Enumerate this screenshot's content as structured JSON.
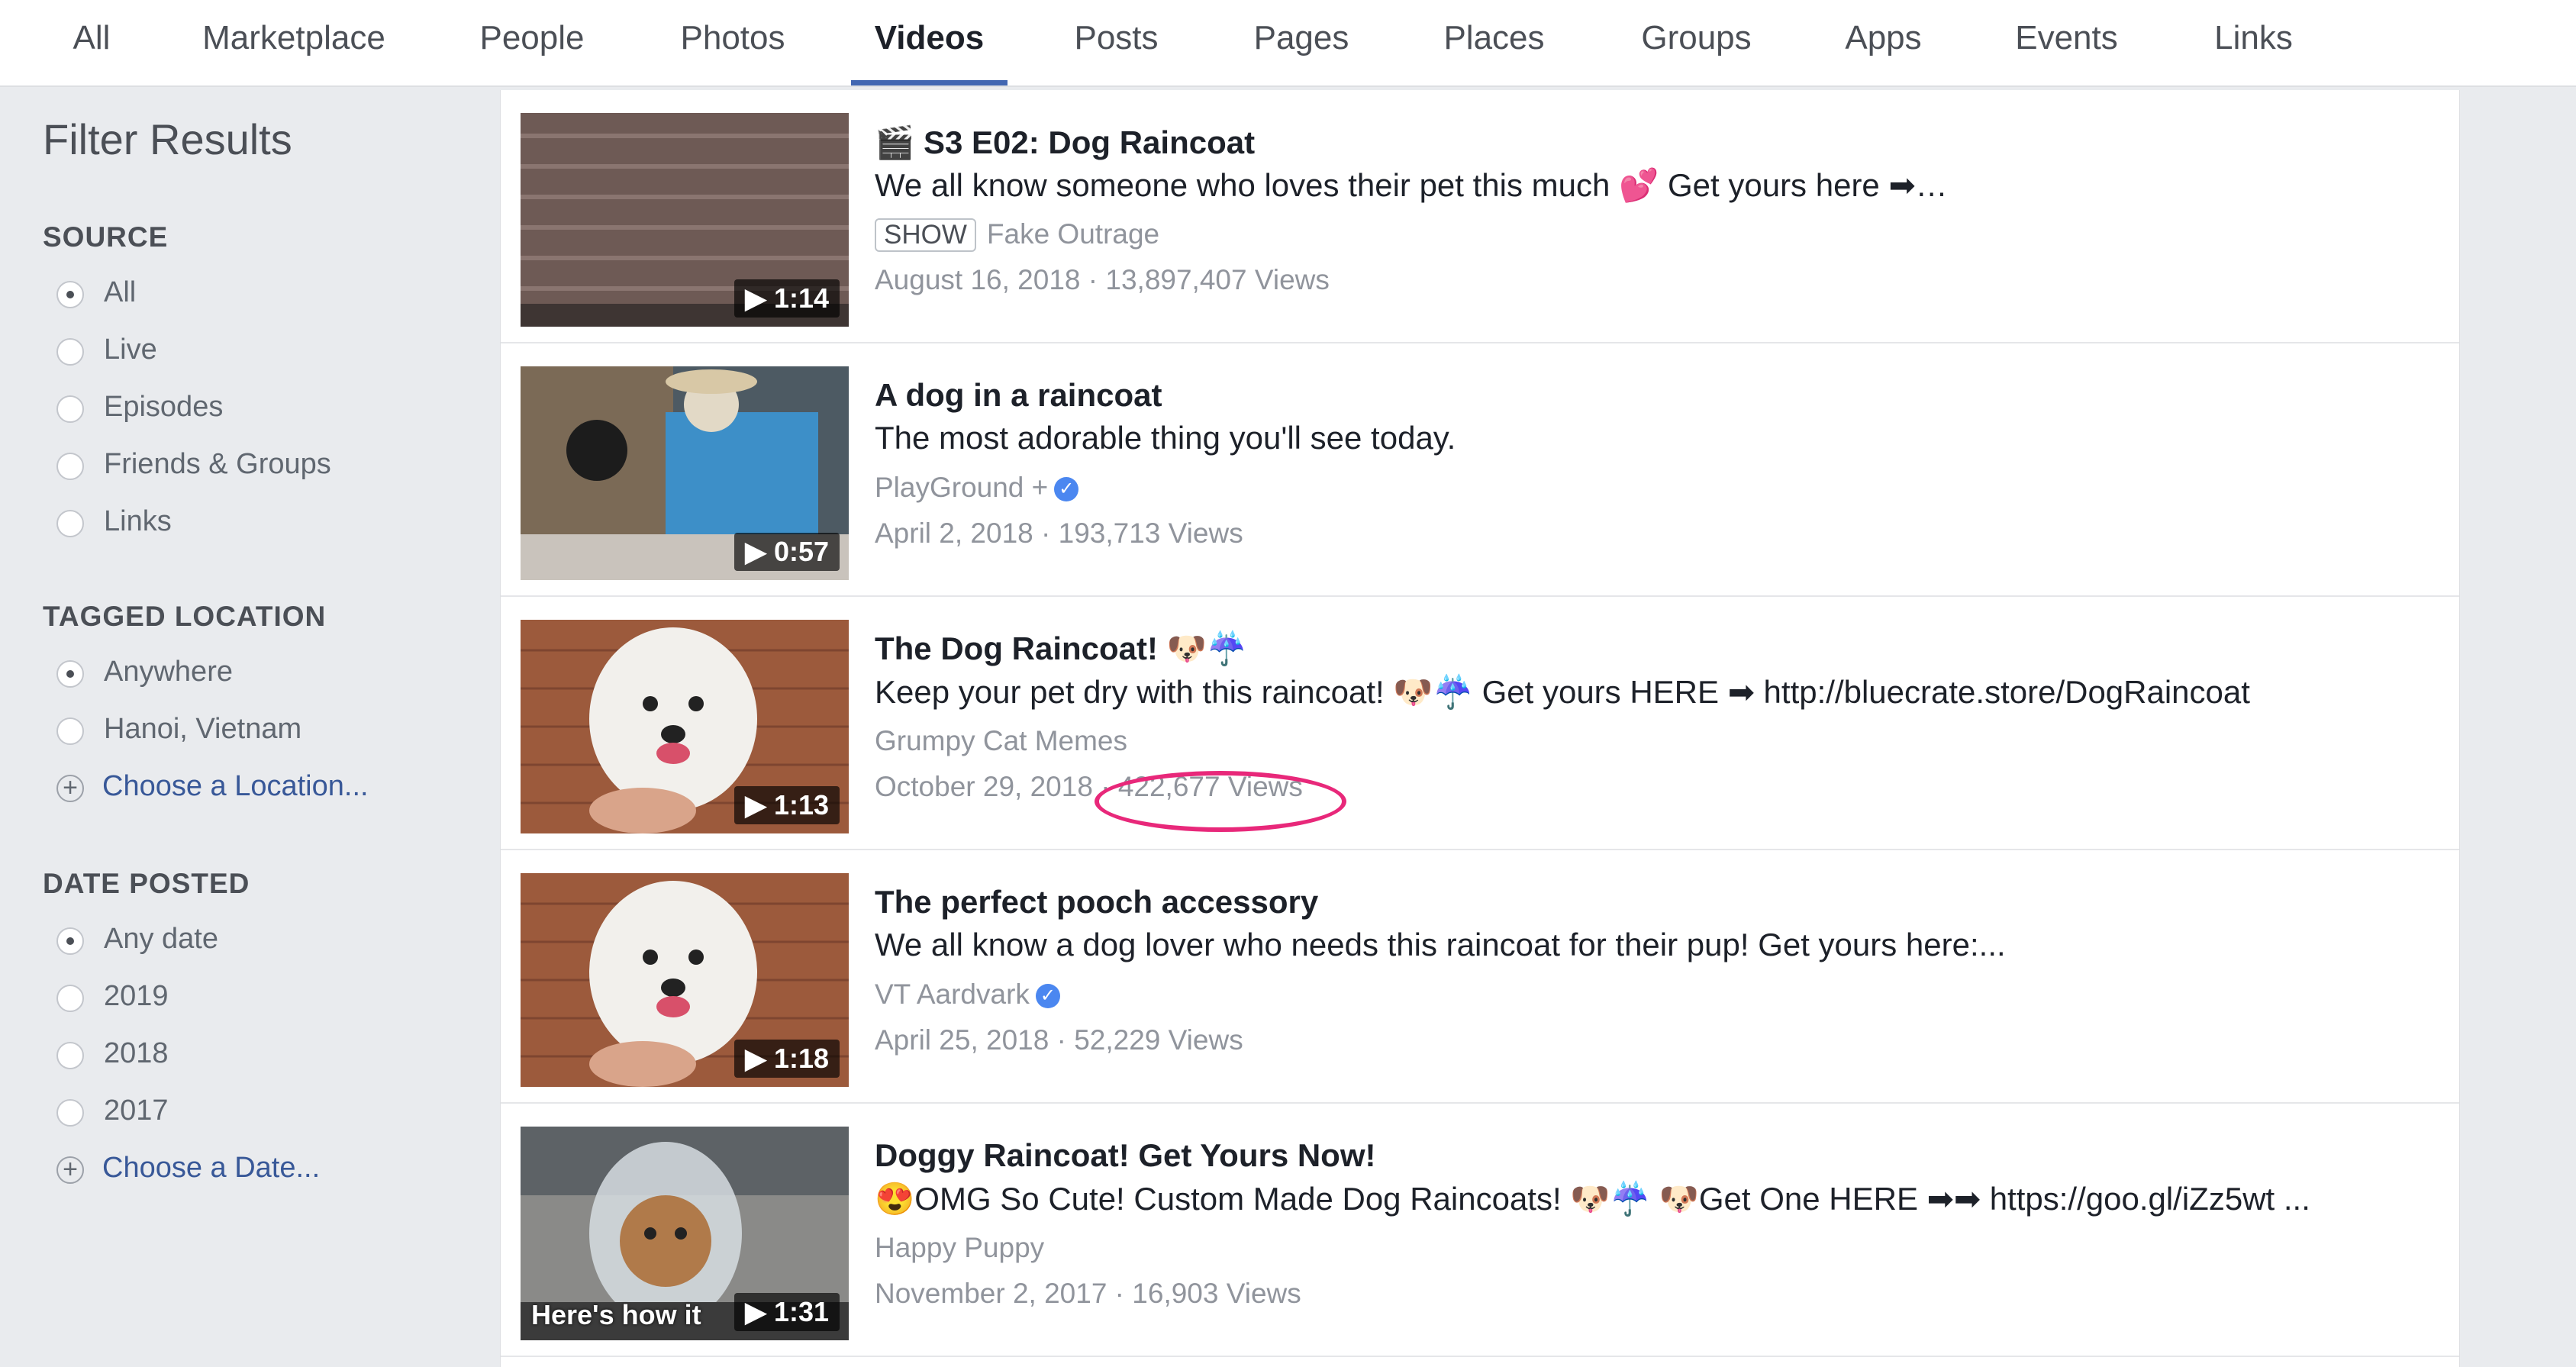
{
  "tabs": [
    "All",
    "Marketplace",
    "People",
    "Photos",
    "Videos",
    "Posts",
    "Pages",
    "Places",
    "Groups",
    "Apps",
    "Events",
    "Links"
  ],
  "active_tab": "Videos",
  "sidebar": {
    "title": "Filter Results",
    "source": {
      "heading": "SOURCE",
      "options": [
        "All",
        "Live",
        "Episodes",
        "Friends & Groups",
        "Links"
      ],
      "selected": "All"
    },
    "location": {
      "heading": "TAGGED LOCATION",
      "options": [
        "Anywhere",
        "Hanoi, Vietnam"
      ],
      "selected": "Anywhere",
      "choose": "Choose a Location..."
    },
    "date": {
      "heading": "DATE POSTED",
      "options": [
        "Any date",
        "2019",
        "2018",
        "2017"
      ],
      "selected": "Any date",
      "choose": "Choose a Date..."
    }
  },
  "results": [
    {
      "title": "S3 E02: Dog Raincoat",
      "desc": "We all know someone who loves their pet this much 💕 Get yours here ➡…",
      "badge": "SHOW",
      "source": "Fake Outrage",
      "date": "August 16, 2018",
      "views": "13,897,407 Views",
      "duration": "1:14"
    },
    {
      "title": "A dog in a raincoat",
      "desc": "The most adorable thing you'll see today.",
      "source": "PlayGround +",
      "verified": true,
      "date": "April 2, 2018",
      "views": "193,713 Views",
      "duration": "0:57"
    },
    {
      "title": "The Dog Raincoat! 🐶☔",
      "desc": "Keep your pet dry with this raincoat! 🐶☔ Get yours HERE ➡ http://bluecrate.store/DogRaincoat",
      "source": "Grumpy Cat Memes",
      "date": "October 29, 2018",
      "views": "422,677 Views",
      "duration": "1:13"
    },
    {
      "title": "The perfect pooch accessory",
      "desc": "We all know a dog lover who needs this raincoat for their pup! Get yours here:...",
      "source": "VT Aardvark",
      "verified": true,
      "date": "April 25, 2018",
      "views": "52,229 Views",
      "duration": "1:18"
    },
    {
      "title": "Doggy Raincoat! Get Yours Now!",
      "desc": "😍OMG So Cute! Custom Made Dog Raincoats! 🐶☔ 🐶Get One HERE ➡➡ https://goo.gl/iZz5wt ...",
      "source": "Happy Puppy",
      "date": "November 2, 2017",
      "views": "16,903 Views",
      "duration": "1:31",
      "caption": "Here's how it"
    }
  ],
  "colors": {
    "accent": "#4267b2",
    "link": "#385898",
    "highlight": "#e8287a"
  }
}
